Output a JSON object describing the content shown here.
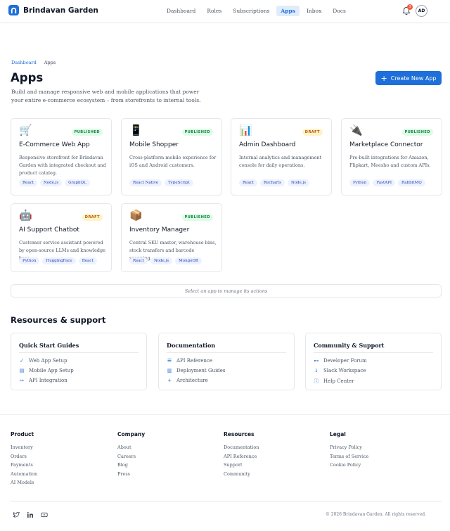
{
  "header": {
    "brand": "Brindavan Garden",
    "nav": [
      {
        "label": "Dashboard",
        "active": false
      },
      {
        "label": "Roles",
        "active": false
      },
      {
        "label": "Subscriptions",
        "active": false
      },
      {
        "label": "Apps",
        "active": true
      },
      {
        "label": "Inbox",
        "active": false
      },
      {
        "label": "Docs",
        "active": false
      }
    ],
    "notification_count": "3",
    "avatar_initials": "AD",
    "accent_color": "#1e6fd9"
  },
  "breadcrumb": {
    "parent": "Dashboard",
    "current": "Apps"
  },
  "page": {
    "title": "Apps",
    "subtitle": "Build and manage responsive web and mobile applications that power your entire e-commerce ecosystem – from storefronts to internal tools.",
    "create_button": "Create New App"
  },
  "apps": [
    {
      "icon": "shopping-cart-icon",
      "glyph": "🛒",
      "status": "PUBLISHED",
      "title": "E-Commerce Web App",
      "desc": "Responsive storefront for Brindavan Garden with integrated checkout and product catalog.",
      "tags": [
        "React",
        "Node.js",
        "GraphQL"
      ]
    },
    {
      "icon": "mobile-phone-icon",
      "glyph": "📱",
      "status": "PUBLISHED",
      "title": "Mobile Shopper",
      "desc": "Cross-platform mobile experience for iOS and Android customers.",
      "tags": [
        "React Native",
        "TypeScript"
      ]
    },
    {
      "icon": "bar-chart-icon",
      "glyph": "📊",
      "status": "DRAFT",
      "title": "Admin Dashboard",
      "desc": "Internal analytics and management console for daily operations.",
      "tags": [
        "React",
        "Recharts",
        "Node.js"
      ]
    },
    {
      "icon": "plug-icon",
      "glyph": "🔌",
      "status": "PUBLISHED",
      "title": "Marketplace Connector",
      "desc": "Pre-built integrations for Amazon, Flipkart, Meesho and custom APIs.",
      "tags": [
        "Python",
        "FastAPI",
        "RabbitMQ"
      ]
    },
    {
      "icon": "robot-icon",
      "glyph": "🤖",
      "status": "DRAFT",
      "title": "AI Support Chatbot",
      "desc": "Customer service assistant powered by open-source LLMs and knowledge base.",
      "tags": [
        "Python",
        "HuggingFace",
        "React"
      ]
    },
    {
      "icon": "package-icon",
      "glyph": "📦",
      "status": "PUBLISHED",
      "title": "Inventory Manager",
      "desc": "Central SKU master, warehouse bins, stock transfers and barcode scanning.",
      "tags": [
        "React",
        "Node.js",
        "MongoDB"
      ]
    }
  ],
  "select_hint": "Select an app to manage its actions",
  "resources": {
    "title": "Resources & support",
    "cards": [
      {
        "title": "Quick Start Guides",
        "items": [
          {
            "icon": "check-icon",
            "glyph": "✓",
            "label": "Web App Setup"
          },
          {
            "icon": "mobile-icon",
            "glyph": "▤",
            "label": "Mobile App Setup"
          },
          {
            "icon": "api-icon",
            "glyph": "↦",
            "label": "API Integration"
          }
        ]
      },
      {
        "title": "Documentation",
        "items": [
          {
            "icon": "list-icon",
            "glyph": "☰",
            "label": "API Reference"
          },
          {
            "icon": "chart-icon",
            "glyph": "▥",
            "label": "Deployment Guides"
          },
          {
            "icon": "plus-icon",
            "glyph": "+",
            "label": "Architecture"
          }
        ]
      },
      {
        "title": "Community & Support",
        "items": [
          {
            "icon": "forum-icon",
            "glyph": "⊷",
            "label": "Developer Forum"
          },
          {
            "icon": "slack-icon",
            "glyph": "↓",
            "label": "Slack Workspace"
          },
          {
            "icon": "help-icon",
            "glyph": "ⓘ",
            "label": "Help Center"
          }
        ]
      }
    ]
  },
  "footer": {
    "columns": [
      {
        "title": "Product",
        "links": [
          "Inventory",
          "Orders",
          "Payments",
          "Automation",
          "AI Models"
        ]
      },
      {
        "title": "Company",
        "links": [
          "About",
          "Careers",
          "Blog",
          "Press"
        ]
      },
      {
        "title": "Resources",
        "links": [
          "Documentation",
          "API Reference",
          "Support",
          "Community"
        ]
      },
      {
        "title": "Legal",
        "links": [
          "Privacy Policy",
          "Terms of Service",
          "Cookie Policy"
        ]
      }
    ],
    "copyright": "© 2026 Brindavan Garden. All rights reserved."
  }
}
